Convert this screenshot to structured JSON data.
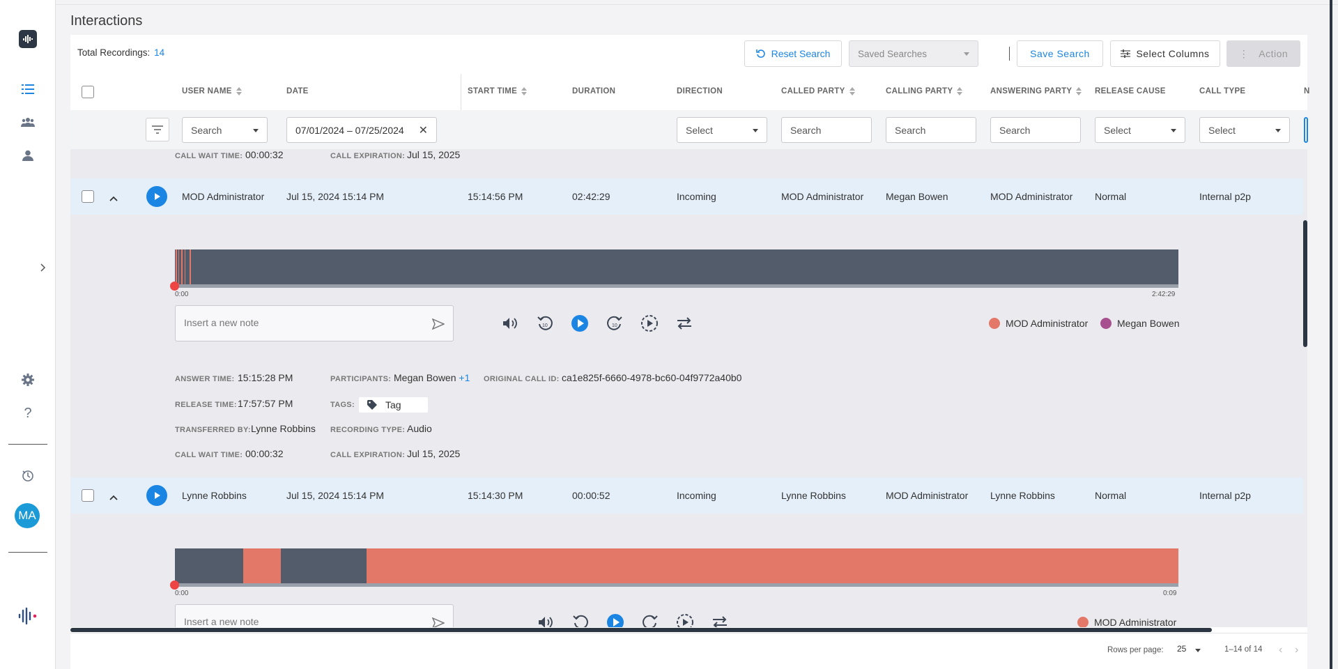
{
  "page": {
    "title": "Interactions"
  },
  "toolbar": {
    "total_label": "Total Recordings:",
    "total_value": "14",
    "reset_label": "Reset Search",
    "saved_searches_placeholder": "Saved Searches",
    "save_label": "Save Search",
    "columns_label": "Select Columns",
    "action_label": "Action"
  },
  "columns": {
    "user_name": "USER NAME",
    "date": "DATE",
    "start_time": "START TIME",
    "duration": "DURATION",
    "direction": "DIRECTION",
    "called_party": "CALLED PARTY",
    "calling_party": "CALLING PARTY",
    "answering_party": "ANSWERING PARTY",
    "release_cause": "RELEASE CAUSE",
    "call_type": "CALL TYPE",
    "extra": "N"
  },
  "filters": {
    "user_name": "Search",
    "date_range": "07/01/2024 – 07/25/2024",
    "direction": "Select",
    "called_party": "Search",
    "calling_party": "Search",
    "answering_party": "Search",
    "release_cause": "Select",
    "call_type": "Select"
  },
  "partial_details": {
    "call_wait_label": "CALL WAIT TIME:",
    "call_wait_value": "00:00:32",
    "call_expiration_label": "CALL EXPIRATION:",
    "call_expiration_value": "Jul 15, 2025"
  },
  "rows": [
    {
      "user_name": "MOD Administrator",
      "date": "Jul 15, 2024 15:14 PM",
      "start_time": "15:14:56 PM",
      "duration": "02:42:29",
      "direction": "Incoming",
      "called_party": "MOD Administrator",
      "calling_party": "Megan Bowen",
      "answering_party": "MOD Administrator",
      "release_cause": "Normal",
      "call_type": "Internal p2p",
      "player": {
        "start": "0:00",
        "end": "2:42:29",
        "note_placeholder": "Insert a new note",
        "legend": [
          {
            "name": "MOD Administrator",
            "color": "#e37869"
          },
          {
            "name": "Megan Bowen",
            "color": "#a8508f"
          }
        ]
      },
      "details": {
        "answer_time_label": "ANSWER TIME:",
        "answer_time": "15:15:28 PM",
        "participants_label": "PARTICIPANTS:",
        "participants": "Megan Bowen",
        "participants_more": "+1",
        "call_id_label": "ORIGINAL CALL ID:",
        "call_id": "ca1e825f-6660-4978-bc60-04f9772a40b0",
        "release_time_label": "RELEASE TIME:",
        "release_time": "17:57:57 PM",
        "tags_label": "TAGS:",
        "tag": "Tag",
        "transferred_label": "TRANSFERRED BY:",
        "transferred": "Lynne Robbins",
        "recording_type_label": "RECORDING TYPE:",
        "recording_type": "Audio",
        "call_wait_label": "CALL WAIT TIME:",
        "call_wait": "00:00:32",
        "call_expiration_label": "CALL EXPIRATION:",
        "call_expiration": "Jul 15, 2025"
      }
    },
    {
      "user_name": "Lynne Robbins",
      "date": "Jul 15, 2024 15:14 PM",
      "start_time": "15:14:30 PM",
      "duration": "00:00:52",
      "direction": "Incoming",
      "called_party": "Lynne Robbins",
      "calling_party": "MOD Administrator",
      "answering_party": "Lynne Robbins",
      "release_cause": "Normal",
      "call_type": "Internal p2p",
      "player": {
        "start": "0:00",
        "end": "0:09",
        "note_placeholder": "Insert a new note",
        "legend": [
          {
            "name": "MOD Administrator",
            "color": "#e37869"
          }
        ]
      }
    }
  ],
  "sidebar": {
    "avatar_initials": "MA"
  },
  "pagination": {
    "rows_per_page_label": "Rows per page:",
    "rows_per_page": "25",
    "range": "1–14 of 14"
  },
  "colors": {
    "accent": "#1b85e4",
    "waveform": "#525c6b",
    "speaker_salmon": "#e37869",
    "speaker_purple": "#a8508f",
    "row_highlight": "#e4eff9"
  }
}
